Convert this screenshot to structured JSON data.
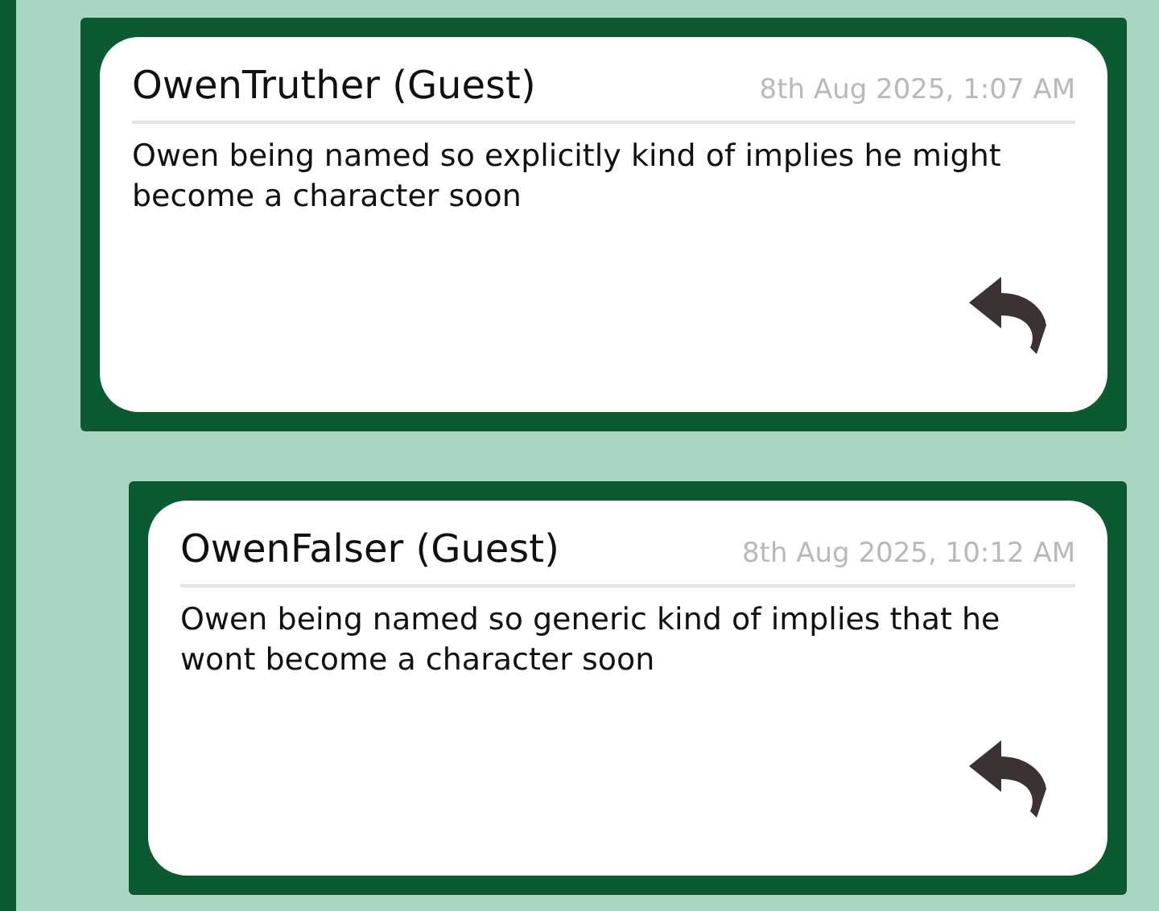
{
  "comments": [
    {
      "author": "OwenTruther (Guest)",
      "date": "8th Aug 2025, 1:07 AM",
      "text": "Owen being named so explicitly kind of implies he might become a character soon",
      "children": [
        {
          "author": "OwenFalser (Guest)",
          "date": "8th Aug 2025, 10:12 AM",
          "text": "Owen being named so generic kind of implies that he wont become a character soon"
        }
      ]
    }
  ]
}
